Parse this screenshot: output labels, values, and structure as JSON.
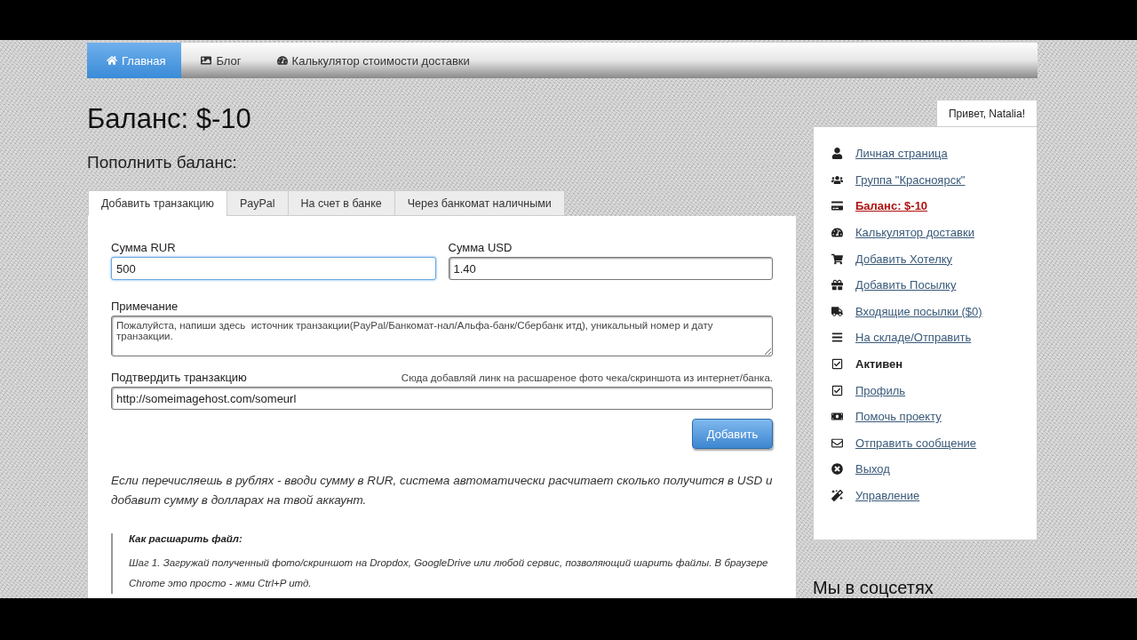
{
  "nav": {
    "items": [
      {
        "label": "Главная",
        "selected": true
      },
      {
        "label": "Блог",
        "selected": false
      },
      {
        "label": "Калькулятор стоимости доставки",
        "selected": false
      }
    ]
  },
  "title": "Баланс: $-10",
  "subtitle": "Пополнить баланс:",
  "tabs": [
    {
      "label": "Добавить транзакцию",
      "selected": true
    },
    {
      "label": "PayPal",
      "selected": false
    },
    {
      "label": "На счет в банке",
      "selected": false
    },
    {
      "label": "Через банкомат наличными",
      "selected": false
    }
  ],
  "form": {
    "amount_rur": {
      "label": "Сумма RUR",
      "value": "500"
    },
    "amount_usd": {
      "label": "Сумма USD",
      "value": "1.40"
    },
    "note": {
      "label": "Примечание",
      "placeholder": "Пожалуйста, напиши здесь  источник транзакции(PayPal/Банкомат-нал/Альфа-банк/Сбербанк итд), уникальный номер и дату транзакции."
    },
    "confirm": {
      "label": "Подтвердить транзакцию",
      "hint": "Сюда добавляй линк на расшареное фото чека/скриншота из интернет/банка.",
      "value": "http://someimagehost.com/someurl"
    },
    "submit": "Добавить"
  },
  "info": "Если перечисляешь в рублях - вводи сумму в RUR, система автоматически расчитает сколько получится в USD и добавит сумму в долларах на твой аккаунт.",
  "howto": {
    "title": "Как расшарить файл:",
    "text": "Шаг 1. Загружай полученный фото/скриншот на Dropdox, GoogleDrive или любой сервис, позволяющий шарить файлы. В браузере Chrome это просто - жми Ctrl+P итд."
  },
  "sidebar": {
    "greeting": "Привет, Natalia!",
    "items": [
      {
        "label": "Личная страница",
        "kind": "link"
      },
      {
        "label": "Группа \"Красноярск\"",
        "kind": "link"
      },
      {
        "label": "Баланс: $-10",
        "kind": "current"
      },
      {
        "label": "Калькулятор доставки",
        "kind": "link"
      },
      {
        "label": "Добавить Хотелку",
        "kind": "link"
      },
      {
        "label": "Добавить Посылку",
        "kind": "link"
      },
      {
        "label": "Входящие посылки ($0)",
        "kind": "link"
      },
      {
        "label": "На складе/Отправить",
        "kind": "link"
      },
      {
        "label": "Активен",
        "kind": "text"
      },
      {
        "label": "Профиль",
        "kind": "link"
      },
      {
        "label": "Помочь проекту",
        "kind": "link"
      },
      {
        "label": "Отправить сообщение",
        "kind": "link"
      },
      {
        "label": "Выход",
        "kind": "link"
      },
      {
        "label": "Управление",
        "kind": "link"
      }
    ]
  },
  "social_title": "Мы в соцсетях"
}
